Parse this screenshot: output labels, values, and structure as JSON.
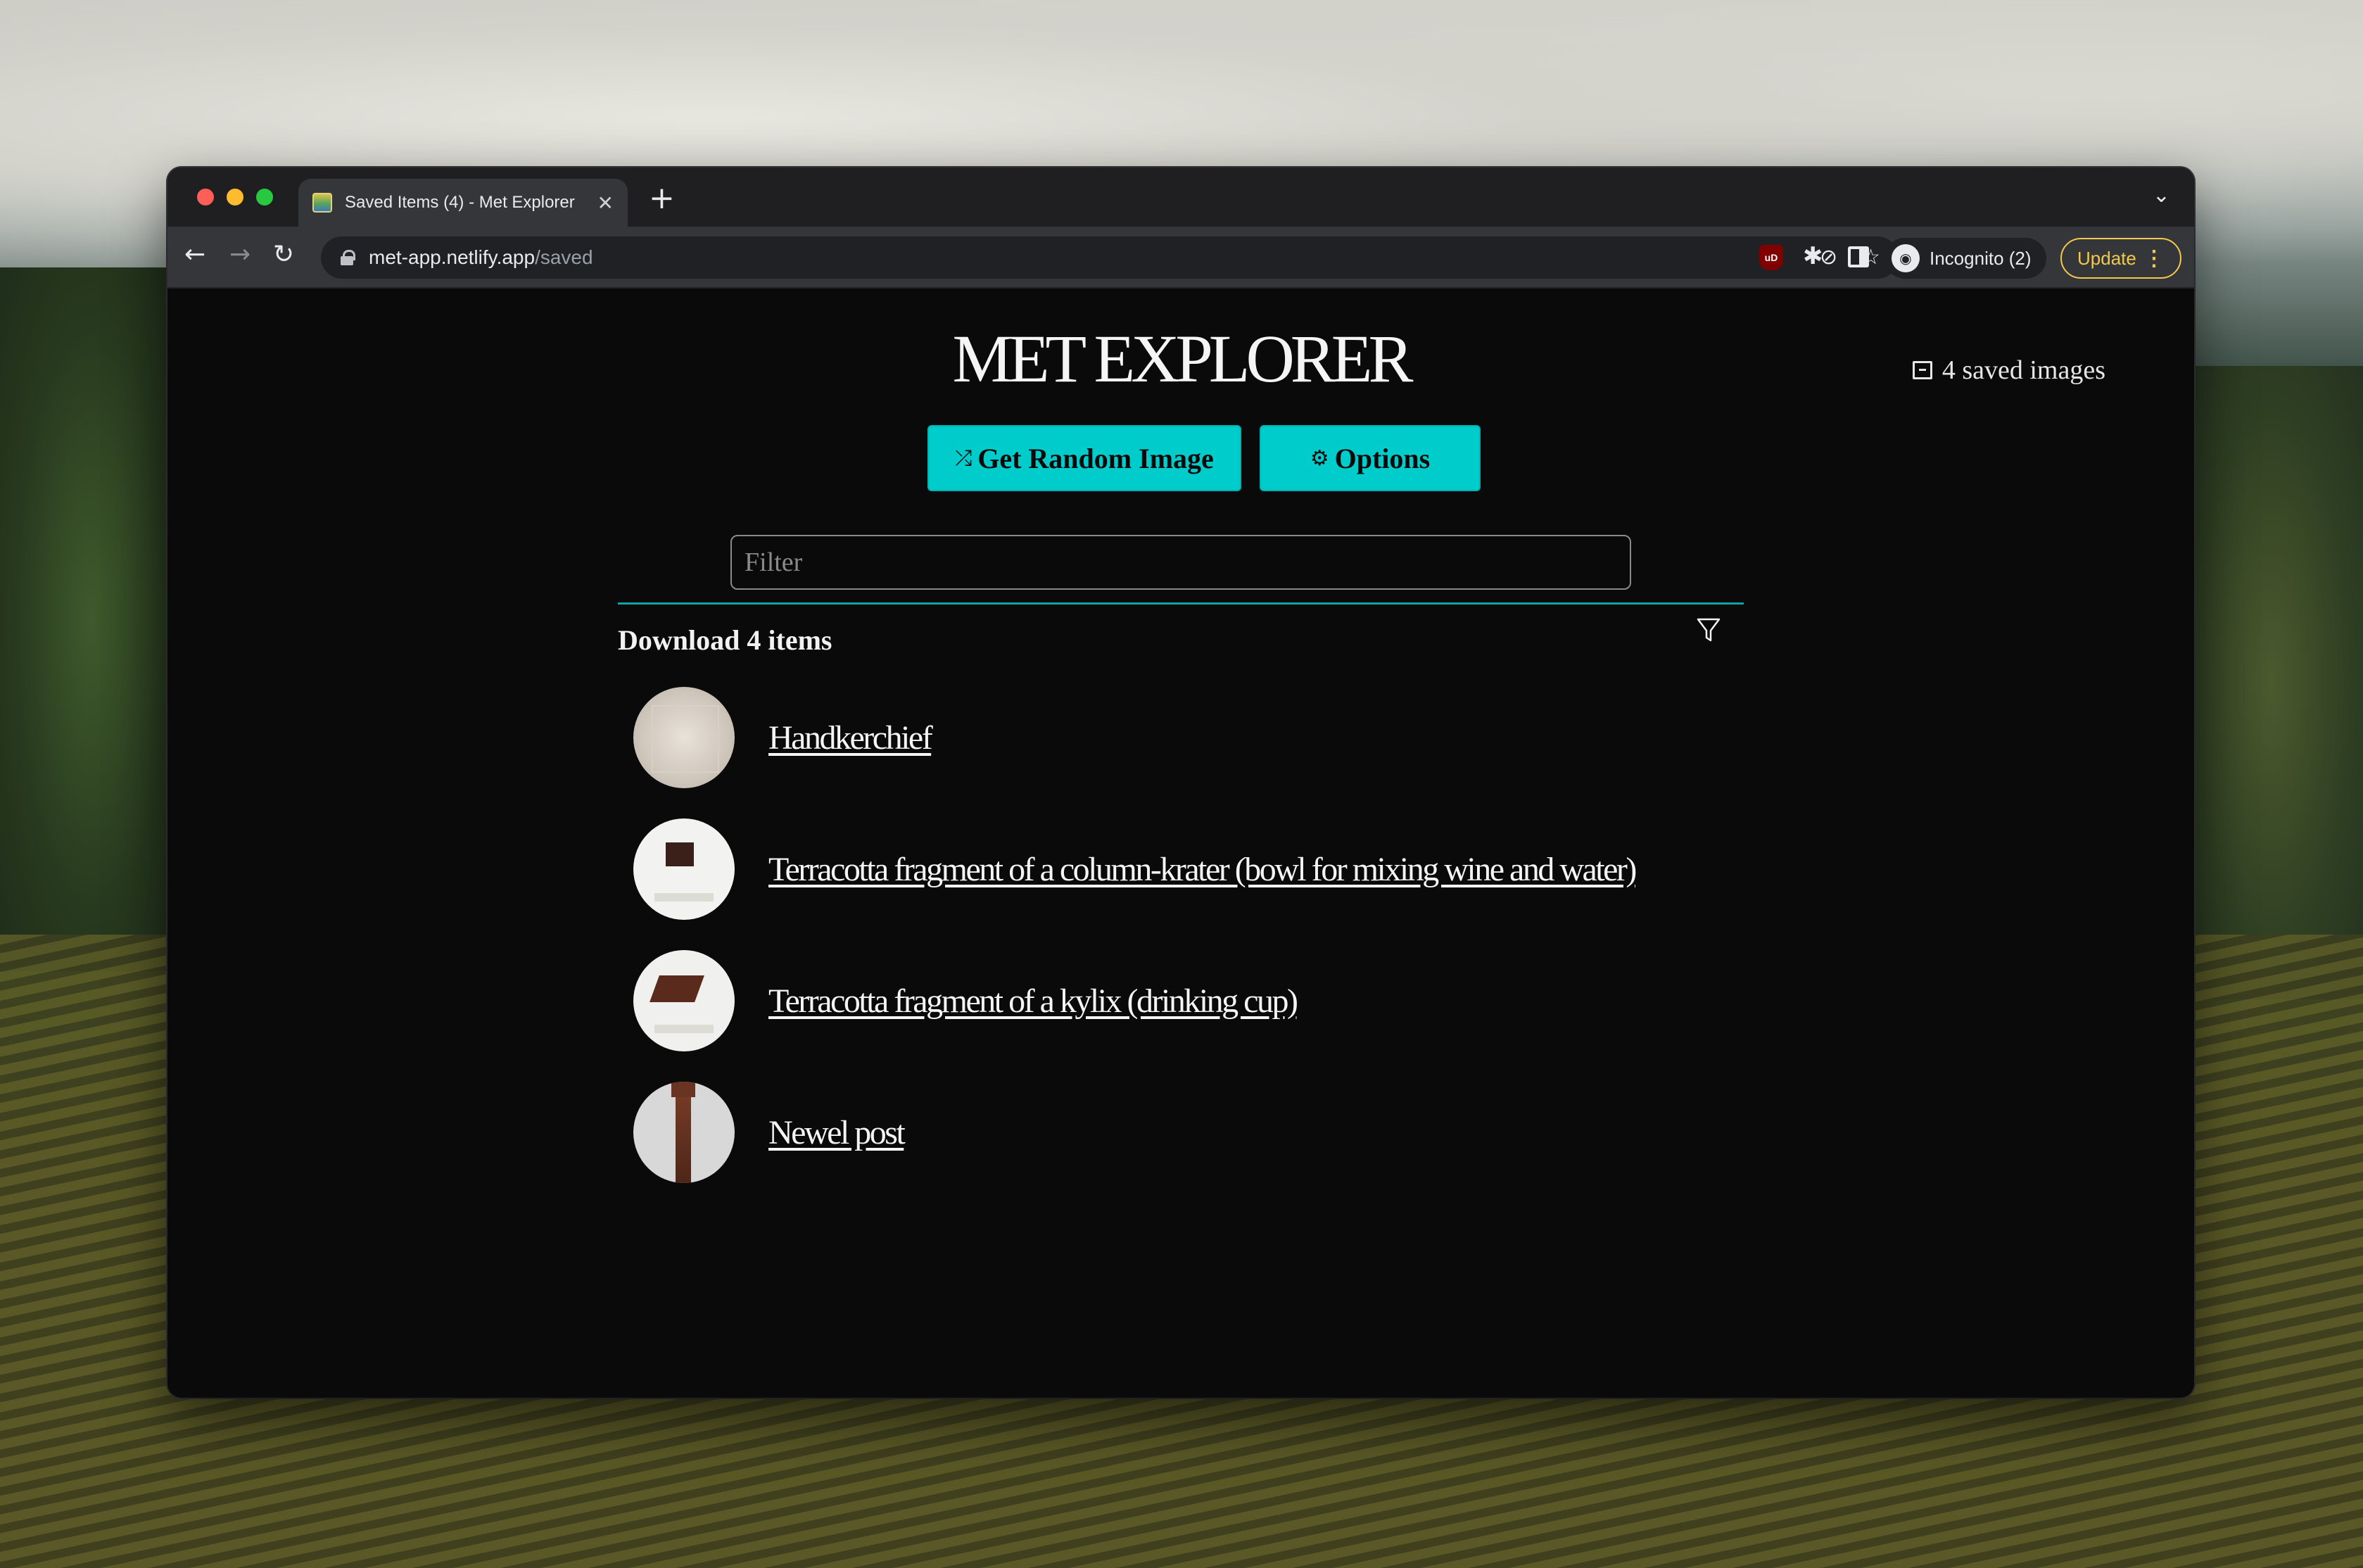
{
  "browser": {
    "tab_title": "Saved Items (4) - Met Explorer",
    "new_tab_symbol": "+",
    "url_host": "met-app.netlify.app",
    "url_path": "/saved",
    "profile_label": "Incognito (2)",
    "update_label": "Update",
    "ublock_label": "uD"
  },
  "page": {
    "title": "MET EXPLORER",
    "saved_count": "4 saved images",
    "random_button": "Get Random Image",
    "options_button": "Options",
    "filter_placeholder": "Filter",
    "download_label": "Download 4 items",
    "items": [
      {
        "title": "Handkerchief"
      },
      {
        "title": "Terracotta fragment of a column-krater (bowl for mixing wine and water)"
      },
      {
        "title": "Terracotta fragment of a kylix (drinking cup)"
      },
      {
        "title": "Newel post"
      }
    ]
  },
  "colors": {
    "accent": "#00cccc",
    "page_background": "#0a0a0a",
    "update_yellow": "#f2c94c"
  },
  "icons": [
    "back-arrow-icon",
    "forward-arrow-icon",
    "reload-icon",
    "lock-icon",
    "eye-slash-icon",
    "star-icon",
    "ublock-icon",
    "puzzle-icon",
    "side-panel-icon",
    "incognito-icon",
    "shuffle-icon",
    "gear-icon",
    "archive-icon",
    "funnel-icon"
  ]
}
